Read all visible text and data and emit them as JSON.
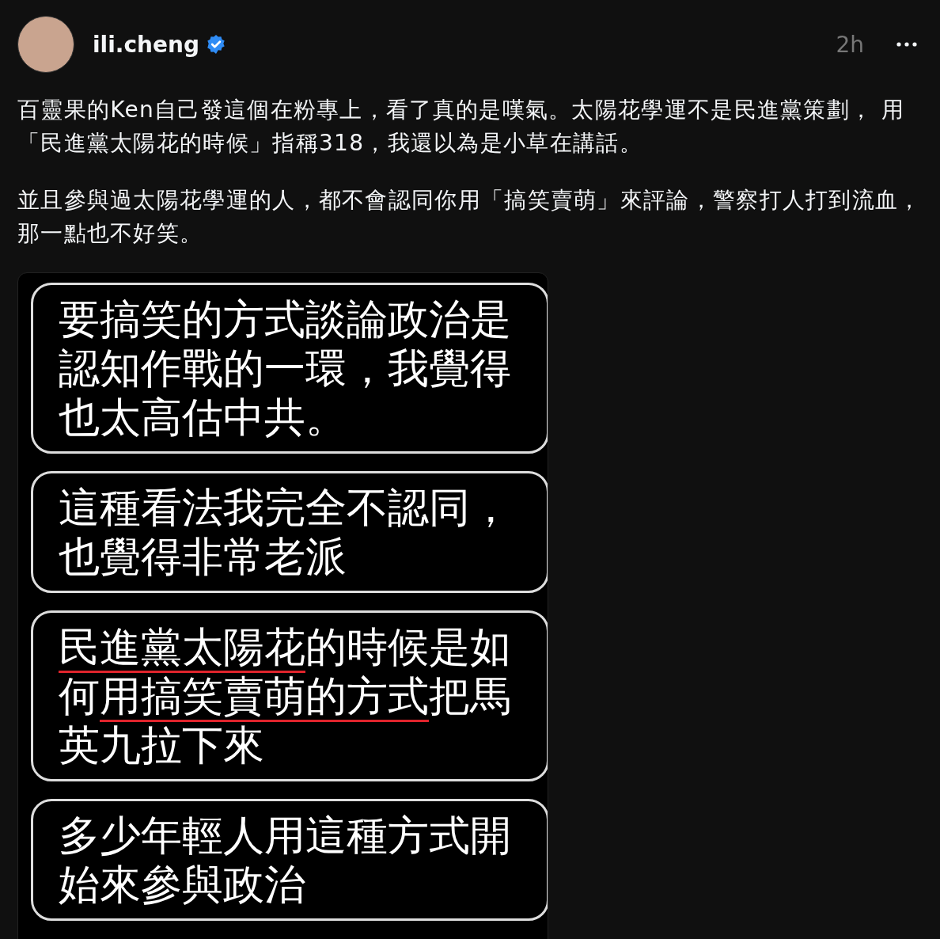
{
  "post": {
    "author": "ili.cheng",
    "verified": true,
    "time": "2h",
    "paragraphs": [
      "百靈果的Ken自己發這個在粉專上，看了真的是嘆氣。太陽花學運不是民進黨策劃， 用「民進黨太陽花的時候」指稱318，我還以為是小草在講話。",
      "並且參與過太陽花學運的人，都不會認同你用「搞笑賣萌」來評論，警察打人打到流血，那一點也不好笑。"
    ],
    "image": {
      "bubbles": [
        {
          "lines": [
            [
              {
                "text": "要搞笑的方式談論政治是",
                "underlined": false
              }
            ],
            [
              {
                "text": "認知作戰的一環，我覺得",
                "underlined": false
              }
            ],
            [
              {
                "text": "也太高估中共。",
                "underlined": false
              }
            ]
          ]
        },
        {
          "lines": [
            [
              {
                "text": "這種看法我完全不認同，",
                "underlined": false
              }
            ],
            [
              {
                "text": "也覺得非常老派",
                "underlined": false
              }
            ]
          ]
        },
        {
          "lines": [
            [
              {
                "text": "民進黨太陽花",
                "underlined": true
              },
              {
                "text": "的時候是如",
                "underlined": false
              }
            ],
            [
              {
                "text": "何",
                "underlined": false
              },
              {
                "text": "用搞笑賣萌的方式",
                "underlined": true
              },
              {
                "text": "把馬",
                "underlined": false
              }
            ],
            [
              {
                "text": "英九拉下來",
                "underlined": false
              }
            ]
          ]
        },
        {
          "lines": [
            [
              {
                "text": "多少年輕人用這種方式開",
                "underlined": false
              }
            ],
            [
              {
                "text": "始來參與政治",
                "underlined": false
              }
            ]
          ]
        }
      ]
    }
  }
}
